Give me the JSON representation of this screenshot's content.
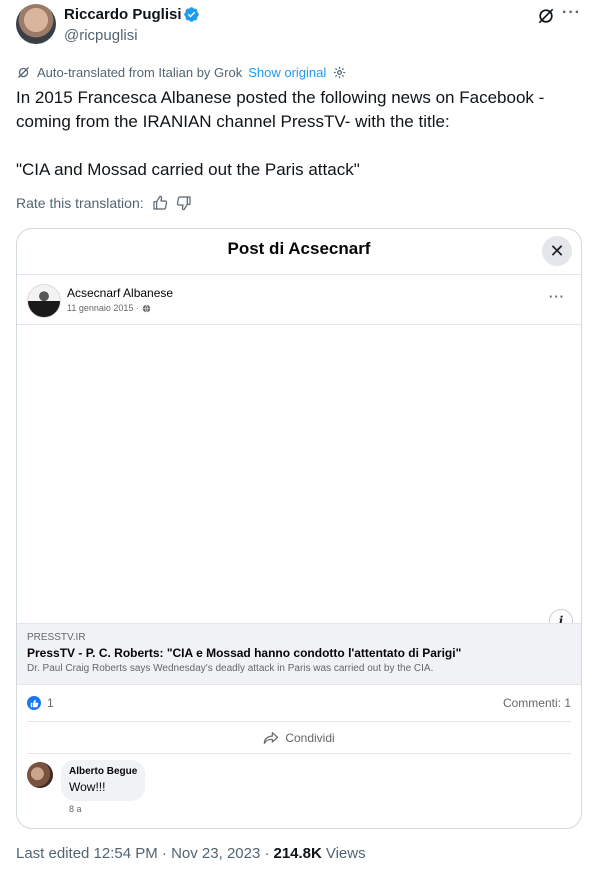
{
  "author": {
    "name": "Riccardo Puglisi",
    "handle": "@ricpuglisi",
    "verified": true
  },
  "translation": {
    "note": "Auto-translated from Italian by Grok",
    "show_original": "Show original",
    "rate_label": "Rate this translation:"
  },
  "tweet": {
    "line1": "In 2015 Francesca Albanese posted the following news on Facebook -",
    "line2": "coming from the IRANIAN channel PressTV- with the title:",
    "line3": "\"CIA and Mossad carried out the Paris attack\""
  },
  "embed": {
    "header_title": "Post di Acsecnarf",
    "close_symbol": "✕",
    "poster_name": "Acsecnarf Albanese",
    "post_date": "11 gennaio 2015 ·",
    "link": {
      "domain": "PRESSTV.IR",
      "title": "PressTV - P. C. Roberts: \"CIA e Mossad hanno condotto l'attentato di Parigi\"",
      "description": "Dr. Paul Craig Roberts says Wednesday's deadly attack in Paris was carried out by the CIA."
    },
    "like_count": "1",
    "comments_label": "Commenti: 1",
    "share_label": "Condividi",
    "comment": {
      "author": "Alberto Begue",
      "text": "Wow!!!",
      "time": "8 a"
    }
  },
  "footer": {
    "edited": "Last edited 12:54 PM · Nov 23, 2023 ·",
    "views": "214.8K",
    "views_label": "Views"
  },
  "colors": {
    "accent": "#1d9bf0",
    "facebook_blue": "#1877f2",
    "muted": "#536471"
  }
}
